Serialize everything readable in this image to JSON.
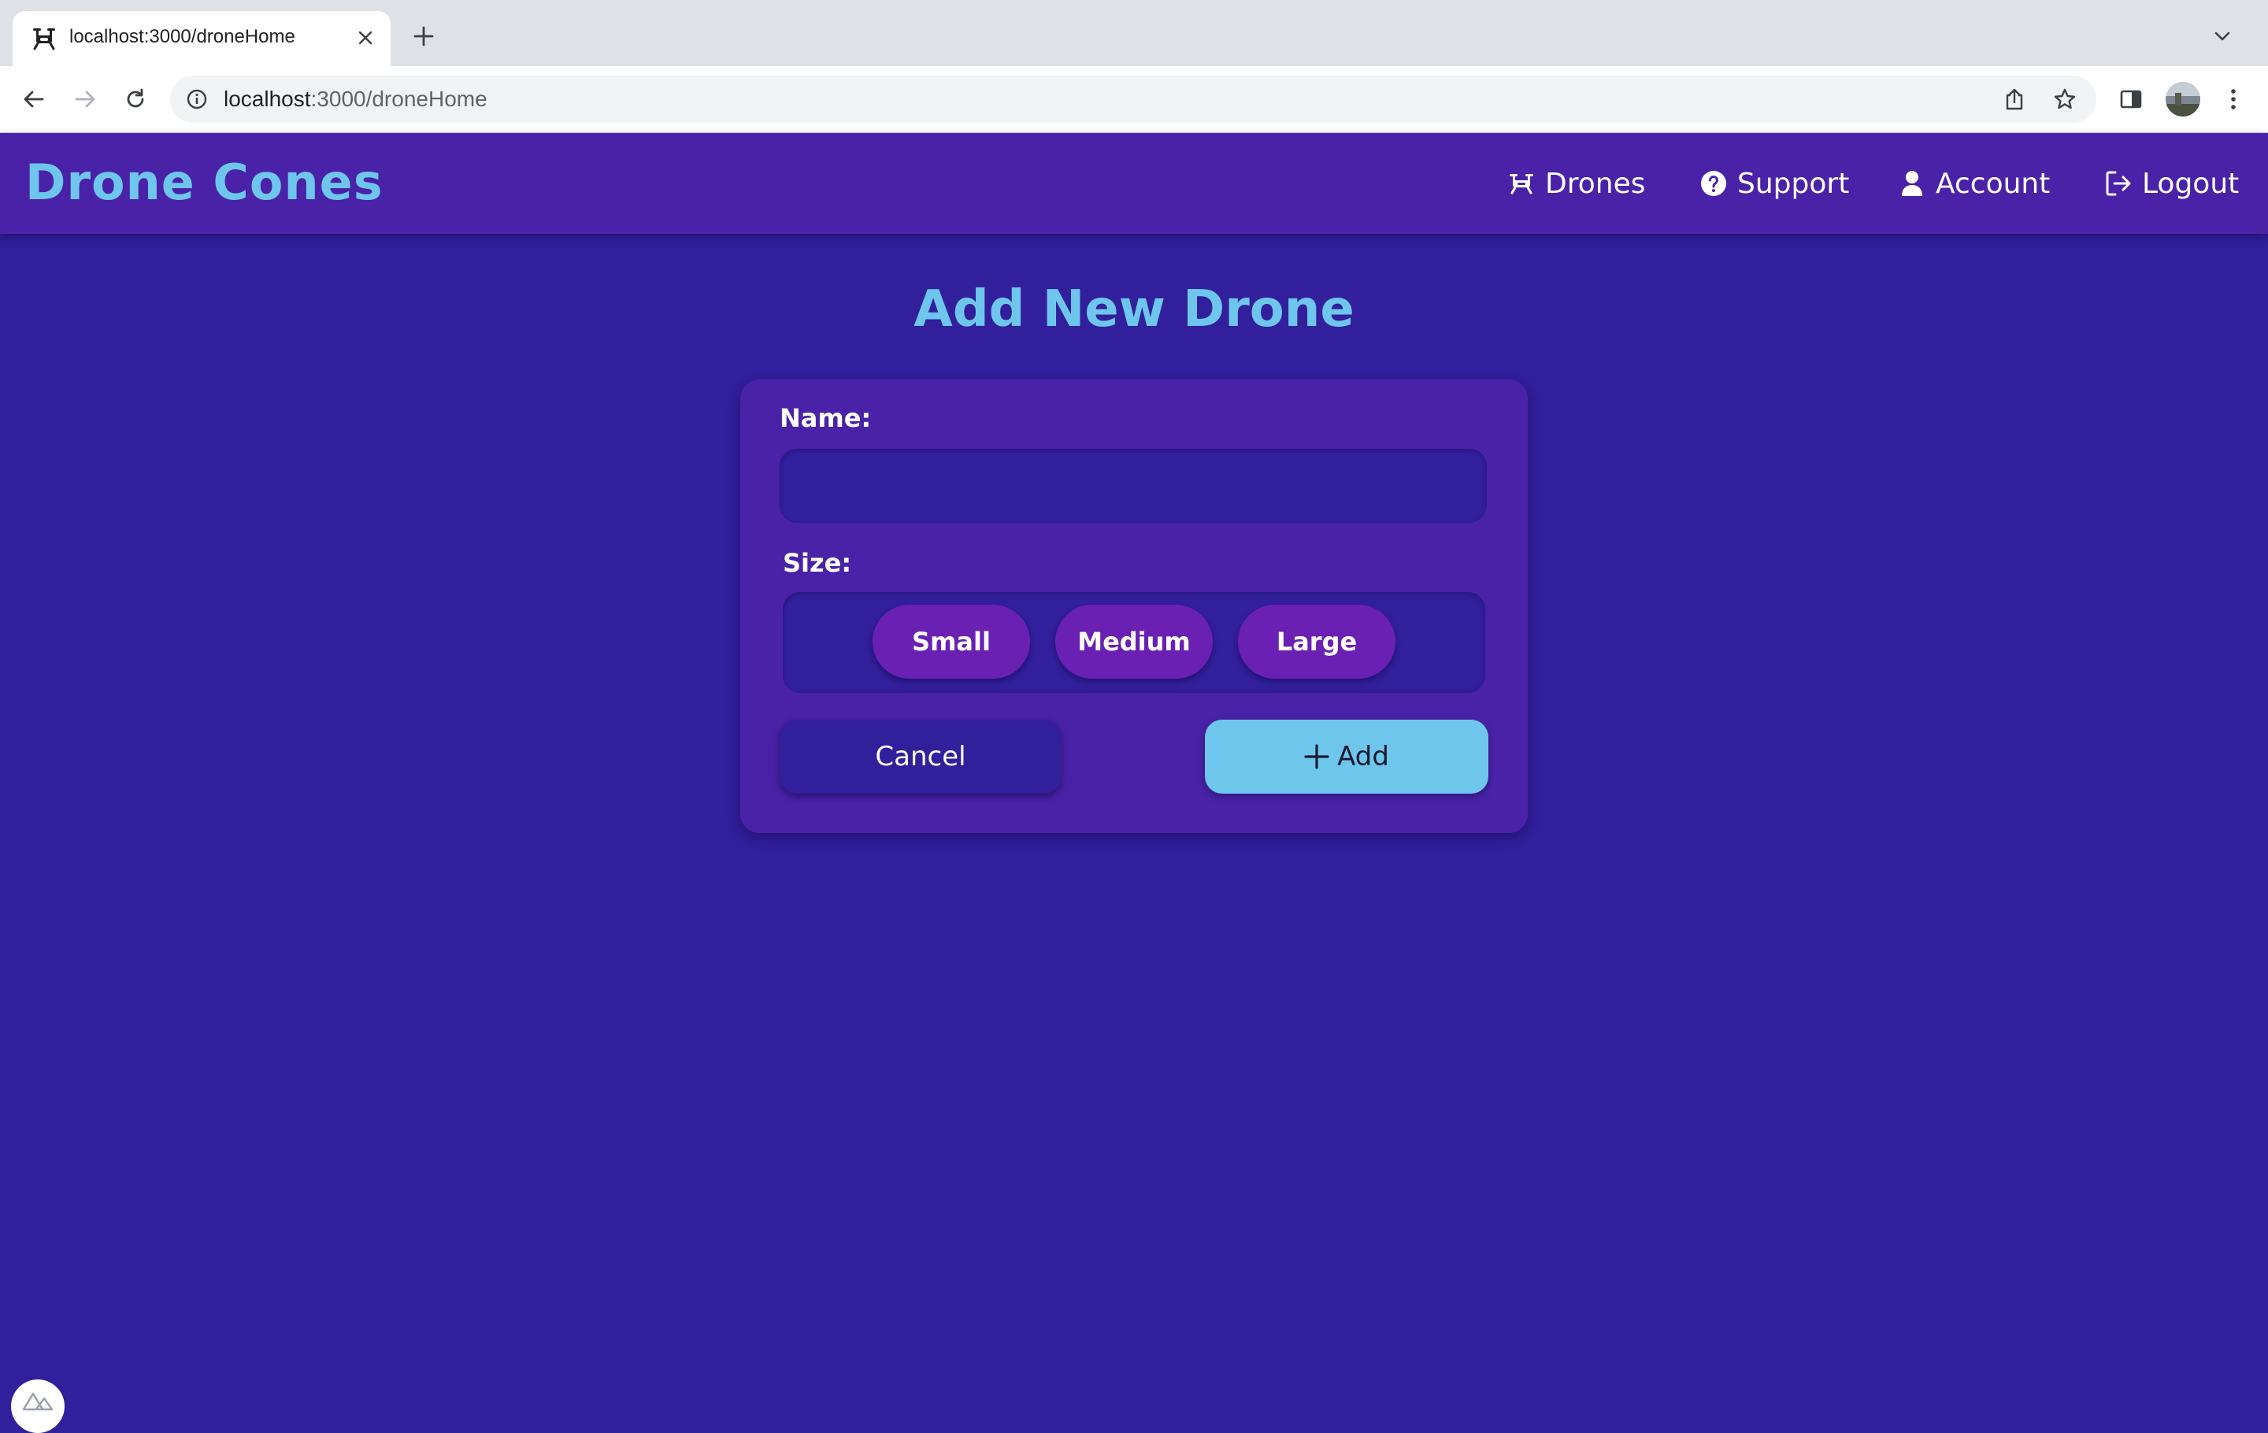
{
  "browser": {
    "tab_title": "localhost:3000/droneHome",
    "url_host": "localhost",
    "url_path": ":3000/droneHome"
  },
  "navbar": {
    "brand": "Drone Cones",
    "items": [
      {
        "label": "Drones",
        "icon": "drone-icon"
      },
      {
        "label": "Support",
        "icon": "question-circle-icon"
      },
      {
        "label": "Account",
        "icon": "user-icon"
      },
      {
        "label": "Logout",
        "icon": "logout-icon"
      }
    ]
  },
  "page": {
    "title": "Add New Drone"
  },
  "form": {
    "name_label": "Name:",
    "name_value": "",
    "size_label": "Size:",
    "size_options": [
      "Small",
      "Medium",
      "Large"
    ],
    "cancel_label": "Cancel",
    "add_label": "Add"
  },
  "colors": {
    "background": "#321f9b",
    "navbar": "#4a22a8",
    "accent": "#6ec6ec",
    "size_button": "#6a21b3"
  }
}
